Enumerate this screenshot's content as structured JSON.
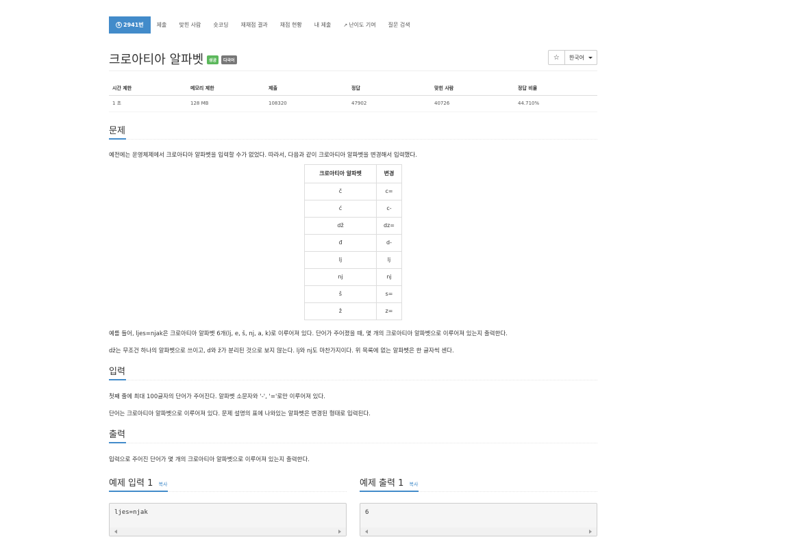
{
  "nav": {
    "problem_number": "2941번",
    "items": [
      "제출",
      "맞힌 사람",
      "숏코딩",
      "재채점 결과",
      "채점 현황",
      "내 제출",
      "난이도 기여",
      "질문 검색"
    ]
  },
  "problem": {
    "title": "크로아티아 알파벳",
    "labels": [
      "성공",
      "다국어"
    ],
    "language": "한국어"
  },
  "info": {
    "headers": [
      "시간 제한",
      "메모리 제한",
      "제출",
      "정답",
      "맞힌 사람",
      "정답 비율"
    ],
    "values": [
      "1 초",
      "128 MB",
      "108320",
      "47902",
      "40726",
      "44.710%"
    ]
  },
  "sections": {
    "description": {
      "heading": "문제",
      "intro": "예전에는 운영체제에서 크로아티아 알파벳을 입력할 수가 없었다. 따라서, 다음과 같이 크로아티아 알파벳을 변경해서 입력했다.",
      "table_headers": [
        "크로아티아 알파벳",
        "변경"
      ],
      "table_rows": [
        [
          "č",
          "c="
        ],
        [
          "ć",
          "c-"
        ],
        [
          "dž",
          "dz="
        ],
        [
          "đ",
          "d-"
        ],
        [
          "lj",
          "lj"
        ],
        [
          "nj",
          "nj"
        ],
        [
          "š",
          "s="
        ],
        [
          "ž",
          "z="
        ]
      ],
      "para2": "예를 들어, ljes=njak은 크로아티아 알파벳 6개(lj, e, š, nj, a, k)로 이루어져 있다. 단어가 주어졌을 때, 몇 개의 크로아티아 알파벳으로 이루어져 있는지 출력한다.",
      "para3": "dž는 무조건 하나의 알파벳으로 쓰이고, d와 ž가 분리된 것으로 보지 않는다. lj와 nj도 마찬가지이다. 위 목록에 없는 알파벳은 한 글자씩 센다."
    },
    "input": {
      "heading": "입력",
      "para1": "첫째 줄에 최대 100글자의 단어가 주어진다. 알파벳 소문자와 '-', '='로만 이루어져 있다.",
      "para2": "단어는 크로아티아 알파벳으로 이루어져 있다. 문제 설명의 표에 나와있는 알파벳은 변경된 형태로 입력된다."
    },
    "output": {
      "heading": "출력",
      "para1": "입력으로 주어진 단어가 몇 개의 크로아티아 알파벳으로 이루어져 있는지 출력한다."
    }
  },
  "samples": {
    "input_heading": "예제 입력 1",
    "output_heading": "예제 출력 1",
    "copy_label": "복사",
    "input_value": "ljes=njak",
    "output_value": "6"
  },
  "colors": {
    "primary": "#428bca",
    "success": "#5cb85c",
    "label_gray": "#777777"
  }
}
